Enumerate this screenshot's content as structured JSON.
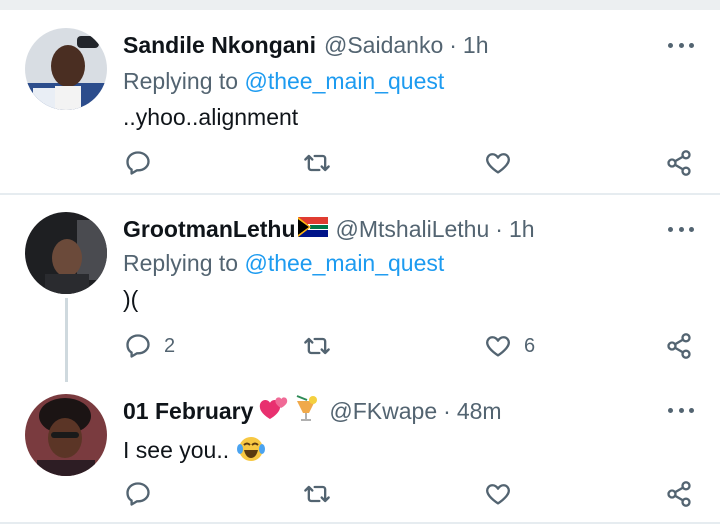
{
  "tweets": [
    {
      "name": "Sandile Nkongani",
      "handle": "@Saidanko",
      "time": "1h",
      "replying_prefix": "Replying to",
      "replying_to": "@thee_main_quest",
      "text": "..yhoo..alignment",
      "reply_count": "",
      "like_count": ""
    },
    {
      "name": "GrootmanLethu",
      "handle": "@MtshaliLethu",
      "time": "1h",
      "replying_prefix": "Replying to",
      "replying_to": "@thee_main_quest",
      "text": ")(",
      "reply_count": "2",
      "like_count": "6"
    },
    {
      "name": "01 February",
      "handle": "@FKwape",
      "time": "48m",
      "text": "I see you..",
      "reply_count": "",
      "like_count": ""
    }
  ],
  "colors": {
    "accent": "#1d9bf0",
    "secondary_text": "#536471",
    "divider": "#e6ecf0"
  },
  "icons": [
    "reply-icon",
    "retweet-icon",
    "like-icon",
    "share-icon",
    "more-icon"
  ]
}
